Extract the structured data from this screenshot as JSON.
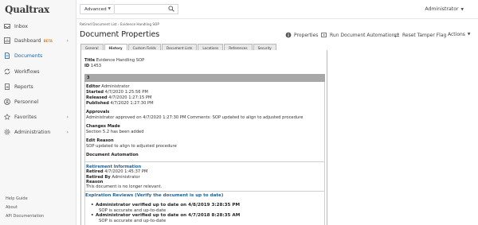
{
  "app": {
    "logo_text": "Qualtrax"
  },
  "sidebar": {
    "items": [
      {
        "label": "Inbox",
        "icon": "inbox-icon"
      },
      {
        "label": "Dashboard",
        "badge": "BETA",
        "icon": "dashboard-icon"
      },
      {
        "label": "Documents",
        "icon": "document-icon",
        "active": true
      },
      {
        "label": "Workflows",
        "icon": "workflow-icon"
      },
      {
        "label": "Reports",
        "icon": "reports-icon"
      },
      {
        "label": "Personnel",
        "icon": "personnel-icon"
      },
      {
        "label": "Favorites",
        "icon": "star-icon"
      },
      {
        "label": "Administration",
        "icon": "gear-icon"
      }
    ],
    "footer_links": [
      "Help Guide",
      "About",
      "API Documentation"
    ]
  },
  "topbar": {
    "search_scope": "Advanced",
    "search_value": "",
    "user_label": "Administrator"
  },
  "breadcrumb": {
    "parent": "Retired Document List",
    "current": "Evidence Handling SOP"
  },
  "page": {
    "title": "Document Properties"
  },
  "actions": {
    "properties": "Properties",
    "run_automation": "Run Document Automation",
    "reset_tamper": "Reset Tamper Flag",
    "actions": "Actions"
  },
  "tabs": [
    "General",
    "History",
    "Custom Fields",
    "Document Lists",
    "Locations",
    "References",
    "Security"
  ],
  "active_tab": "History",
  "document": {
    "title_label": "Title",
    "title_value": "Evidence Handling SOP",
    "id_label": "ID",
    "id_value": "1453"
  },
  "version": {
    "number": "3",
    "editor_label": "Editor",
    "editor": "Administrator",
    "started_label": "Started",
    "started": "4/7/2020 1:25:56 PM",
    "released_label": "Released",
    "released": "4/7/2020 1:27:15 PM",
    "published_label": "Published",
    "published": "4/7/2020 1:27:30 PM",
    "approvals_label": "Approvals",
    "approvals_text": "Administrator approved on 4/7/2020 1:27:30 PM   Comments: SOP updated to align to adjusted procedure",
    "changes_label": "Changes Made",
    "changes_text": "Section 5.2 has been added",
    "edit_reason_label": "Edit Reason",
    "edit_reason_text": "SOP updated to align to adjusted procedure",
    "automation_label": "Document Automation"
  },
  "retirement": {
    "heading": "Retirement Information",
    "retired_label": "Retired",
    "retired": "4/7/2020 1:45:37 PM",
    "retired_by_label": "Retired By",
    "retired_by": "Administrator",
    "reason_label": "Reason",
    "reason_text": "This document is no longer relevant."
  },
  "expiration": {
    "heading": "Expiration Reviews (Verify the document is up to date)",
    "reviews": [
      {
        "title": "Administrator verified up to date on 4/8/2019 3:28:35 PM",
        "note": "SOP is accurate and up-to-date"
      },
      {
        "title": "Administrator verified up to date on 4/7/2018 8:28:35 AM",
        "note": "SOP is accurate and up-to-date"
      }
    ]
  },
  "colors": {
    "accent": "#1d5f9c",
    "beta": "#e08a2d",
    "version_bar": "#a8a8a8"
  }
}
